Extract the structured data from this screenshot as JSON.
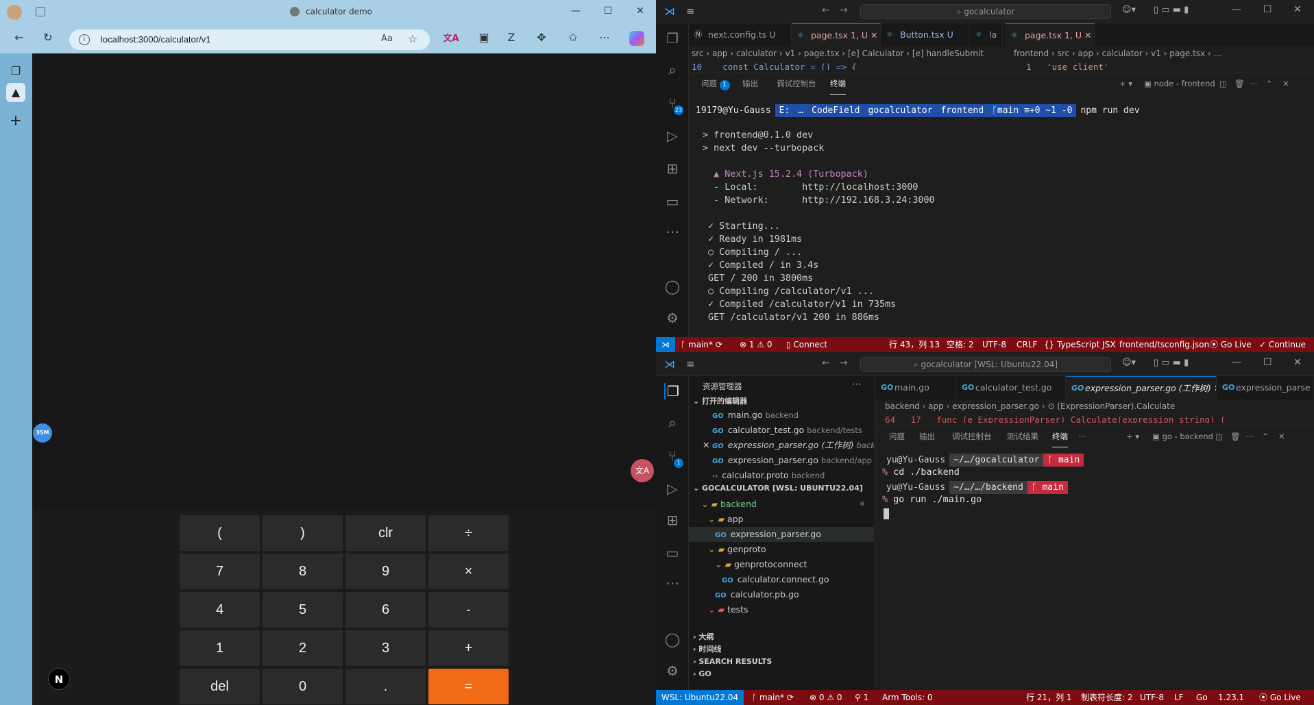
{
  "browser": {
    "title": "calculator demo",
    "url": "localhost:3000/calculator/v1",
    "window_controls": [
      "—",
      "☐",
      "✕"
    ],
    "calculator": {
      "rows": [
        [
          "(",
          ")",
          "clr",
          "÷"
        ],
        [
          "7",
          "8",
          "9",
          "×"
        ],
        [
          "4",
          "5",
          "6",
          "-"
        ],
        [
          "1",
          "2",
          "3",
          "+"
        ],
        [
          "del",
          "0",
          ".",
          "="
        ]
      ]
    },
    "next_logo": "N",
    "badge": "35M",
    "translate_icon": "文A"
  },
  "vscode_top": {
    "search": "gocalculator",
    "tabs": [
      "next.config.ts U",
      "page.tsx 1, U",
      "Button.tsx U",
      "la",
      "page.tsx 1, U"
    ],
    "breadcrumb_left": "src › app › calculator › v1 › page.tsx › [e] Calculator › [e] handleSubmit",
    "breadcrumb_right": "frontend › src › app › calculator › v1 › page.tsx › ...",
    "code_left": "10    const Calculator = () => {",
    "code_right": "1   'use client'",
    "panel_tabs": [
      "问题",
      "输出",
      "调试控制台",
      "终端"
    ],
    "problem_count": "1",
    "terminal_name": "node - frontend",
    "prompt_user": "19179@Yu-Gauss",
    "prompt_path": [
      "E:",
      "…",
      "CodeField",
      "gocalculator",
      "frontend",
      "ᚴmain ≡+0 ~1 -0"
    ],
    "prompt_cmd": "npm run dev",
    "terminal_lines": [
      "> frontend@0.1.0 dev",
      "> next dev --turbopack",
      "",
      "  ▲ Next.js 15.2.4 (Turbopack)",
      "  - Local:        http://localhost:3000",
      "  - Network:      http://192.168.3.24:3000",
      "",
      " ✓ Starting...",
      " ✓ Ready in 1981ms",
      " ○ Compiling / ...",
      " ✓ Compiled / in 3.4s",
      " GET / 200 in 3800ms",
      " ○ Compiling /calculator/v1 ...",
      " ✓ Compiled /calculator/v1 in 735ms",
      " GET /calculator/v1 200 in 886ms"
    ],
    "status": {
      "branch": "main*",
      "errors": "⊗ 1 ⚠ 0",
      "connect": "Connect",
      "position": "行 43，列 13",
      "spaces": "空格: 2",
      "encoding": "UTF-8",
      "eol": "CRLF",
      "lang": "{} TypeScript JSX",
      "config": "frontend/tsconfig.json",
      "golive": "Go Live",
      "continue": "✓ Continue"
    }
  },
  "vscode_bottom": {
    "search": "gocalculator [WSL: Ubuntu22.04]",
    "explorer_title": "资源管理器",
    "open_editors_title": "打开的编辑器",
    "open_editors": [
      {
        "name": "main.go",
        "dir": "backend"
      },
      {
        "name": "calculator_test.go",
        "dir": "backend/tests"
      },
      {
        "name": "expression_parser.go (工作树)",
        "dir": "back..."
      },
      {
        "name": "expression_parser.go",
        "dir": "backend/app"
      },
      {
        "name": "calculator.proto",
        "dir": "backend"
      }
    ],
    "workspace_title": "GOCALCULATOR [WSL: UBUNTU22.04]",
    "tree": [
      {
        "name": "backend",
        "depth": 1
      },
      {
        "name": "app",
        "depth": 2
      },
      {
        "name": "expression_parser.go",
        "depth": 3
      },
      {
        "name": "genproto",
        "depth": 2
      },
      {
        "name": "genprotoconnect",
        "depth": 3
      },
      {
        "name": "calculator.connect.go",
        "depth": 4
      },
      {
        "name": "calculator.pb.go",
        "depth": 3
      },
      {
        "name": "tests",
        "depth": 2
      }
    ],
    "sections": [
      "大纲",
      "时间线",
      "SEARCH RESULTS",
      "GO"
    ],
    "tabs": [
      "main.go",
      "calculator_test.go",
      "expression_parser.go (工作树)",
      "expression_parse"
    ],
    "breadcrumb": "backend › app › expression_parser.go › ⊙ (ExpressionParser).Calculate",
    "code": "64   17   func (e ExpressionParser) Calculate(expression string) (",
    "panel_tabs": [
      "问题",
      "输出",
      "调试控制台",
      "测试结果",
      "终端"
    ],
    "terminal_name": "go - backend",
    "term": [
      {
        "user": "yu@Yu-Gauss",
        "path": "~/…/gocalculator",
        "branch": "ᚴ main",
        "cmd": "cd ./backend"
      },
      {
        "user": "yu@Yu-Gauss",
        "path": "~/…/…/backend",
        "branch": "ᚴ main",
        "cmd": "go run ./main.go"
      }
    ],
    "status": {
      "wsl": "WSL: Ubuntu22.04",
      "branch": "main*",
      "errors": "⊗ 0 ⚠ 0",
      "ports": "1",
      "arm": "Arm Tools: 0",
      "position": "行 21，列 1",
      "tab": "制表符长度: 2",
      "encoding": "UTF-8",
      "eol": "LF",
      "lang": "Go",
      "ver": "1.23.1",
      "golive": "Go Live"
    }
  }
}
